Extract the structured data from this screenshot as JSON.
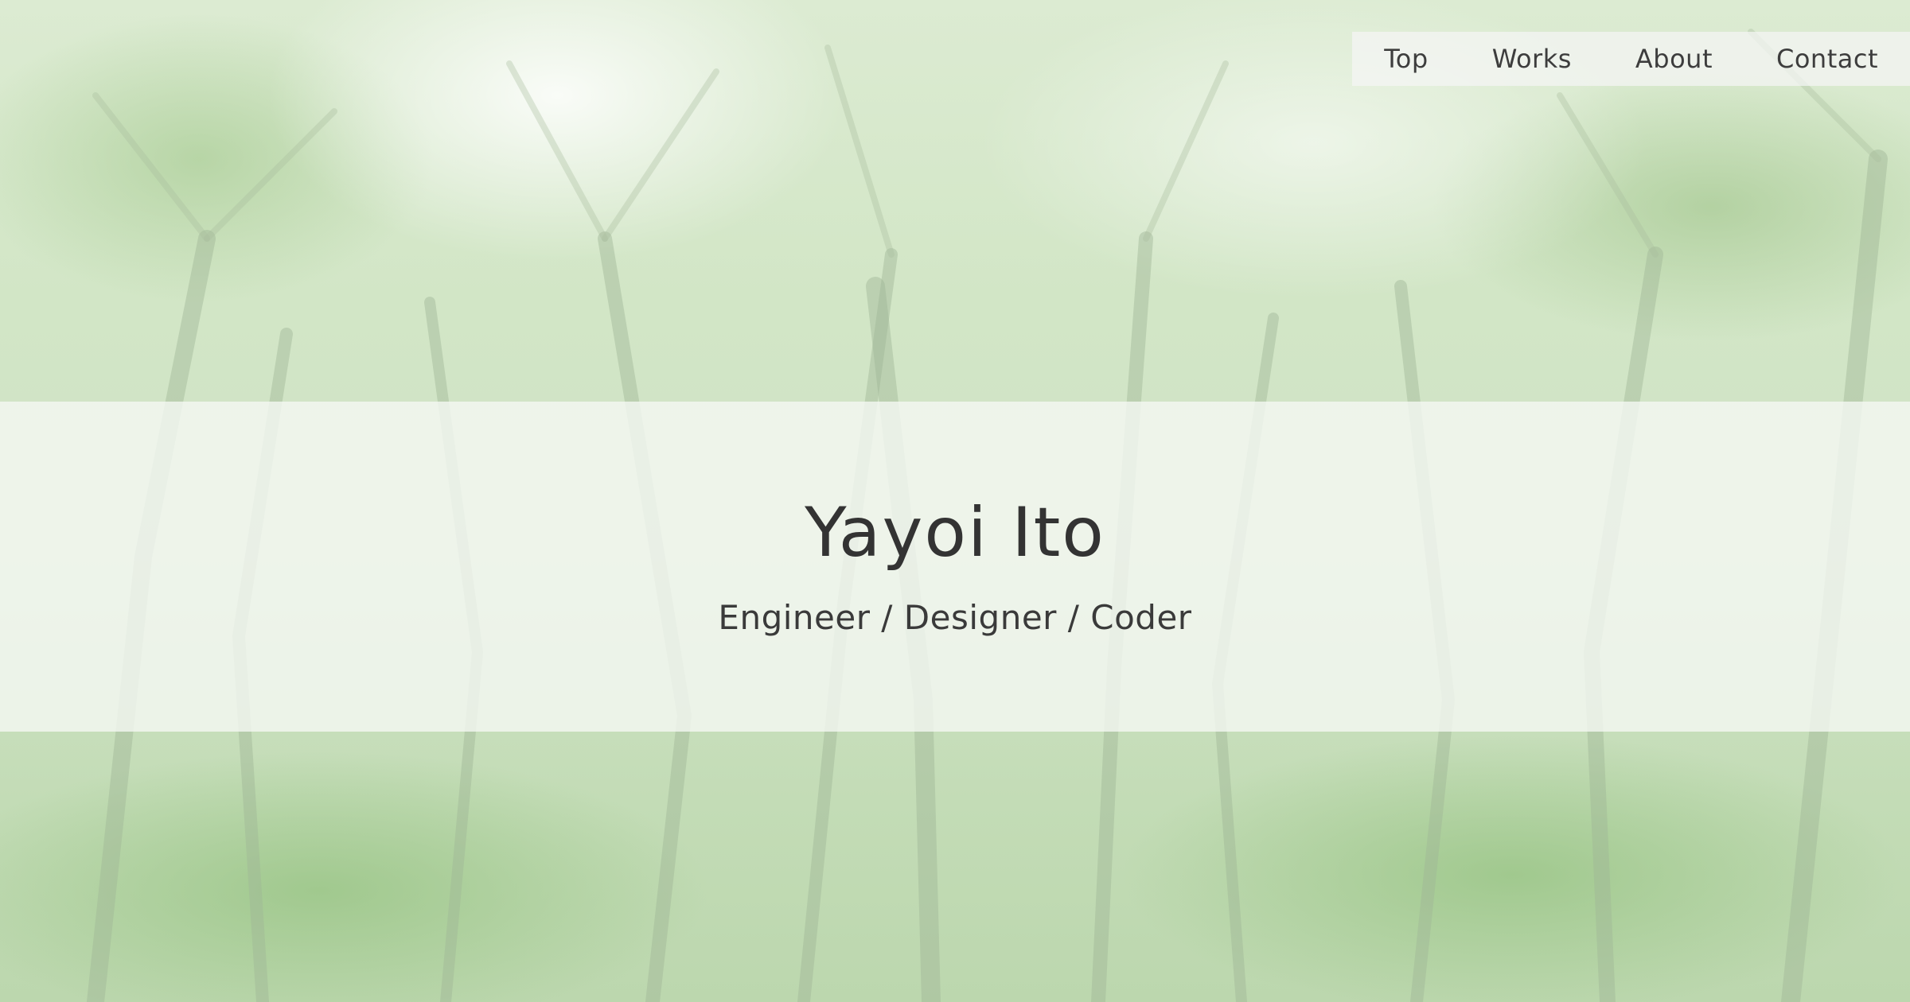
{
  "nav": {
    "items": [
      {
        "label": "Top"
      },
      {
        "label": "Works"
      },
      {
        "label": "About"
      },
      {
        "label": "Contact"
      }
    ]
  },
  "hero": {
    "name": "Yayoi Ito",
    "tagline": "Engineer / Designer / Coder"
  },
  "colors": {
    "text": "#333333",
    "nav_background": "#f5f5f5",
    "band_background": "#f6f8f5",
    "foliage": "#cfe2c5"
  }
}
